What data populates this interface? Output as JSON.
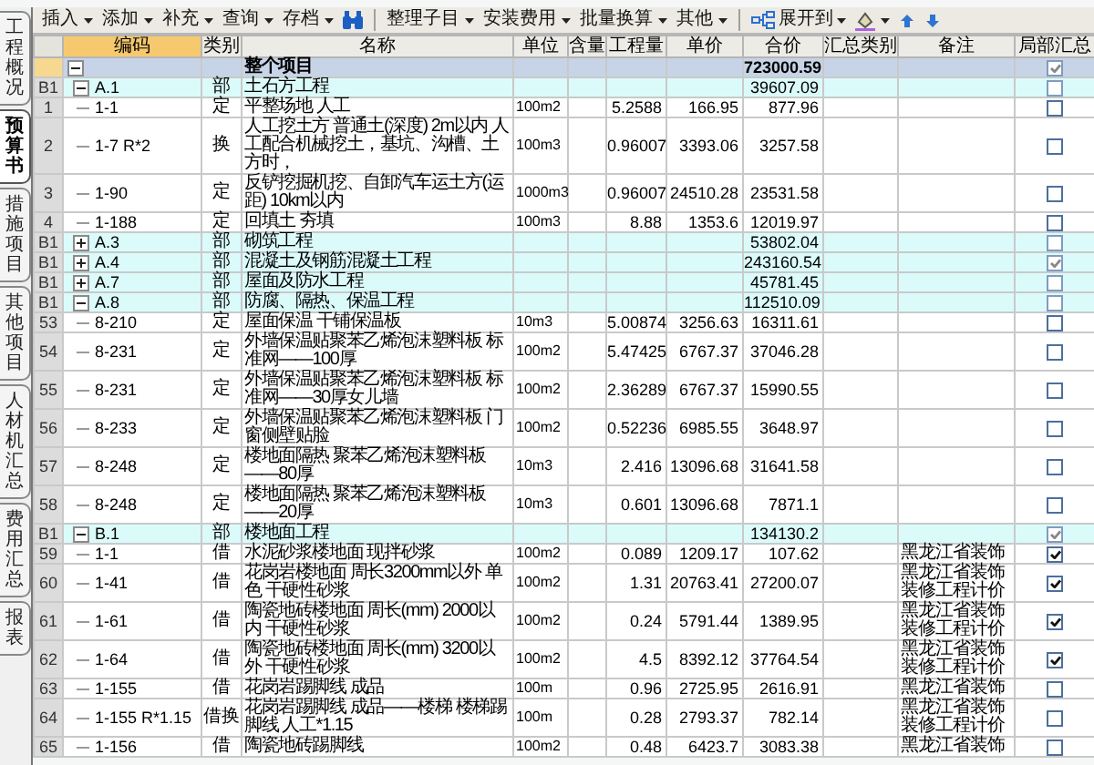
{
  "side_tabs": [
    {
      "label": "工程概况",
      "selected": false
    },
    {
      "label": "预算书",
      "selected": true
    },
    {
      "label": "措施项目",
      "selected": false
    },
    {
      "label": "其他项目",
      "selected": false
    },
    {
      "label": "人材机汇总",
      "selected": false
    },
    {
      "label": "费用汇总",
      "selected": false
    },
    {
      "label": "报表",
      "selected": false
    }
  ],
  "toolbar": [
    {
      "kind": "menu",
      "label": "插入"
    },
    {
      "kind": "menu",
      "label": "添加"
    },
    {
      "kind": "menu",
      "label": "补充"
    },
    {
      "kind": "menu",
      "label": "查询"
    },
    {
      "kind": "menu",
      "label": "存档"
    },
    {
      "kind": "search"
    },
    {
      "kind": "separator"
    },
    {
      "kind": "menu",
      "label": "整理子目"
    },
    {
      "kind": "menu",
      "label": "安装费用"
    },
    {
      "kind": "menu",
      "label": "批量换算"
    },
    {
      "kind": "menu",
      "label": "其他"
    },
    {
      "kind": "separator"
    },
    {
      "kind": "expand",
      "label": "展开到"
    },
    {
      "kind": "fill"
    },
    {
      "kind": "up"
    },
    {
      "kind": "down"
    }
  ],
  "table": {
    "columns": [
      {
        "label": "编码",
        "selected": true
      },
      {
        "label": "类别",
        "selected": false
      },
      {
        "label": "名称",
        "selected": false
      },
      {
        "label": "单位",
        "selected": false
      },
      {
        "label": "含量",
        "selected": false
      },
      {
        "label": "工程量",
        "selected": false
      },
      {
        "label": "单价",
        "selected": false
      },
      {
        "label": "合价",
        "selected": false
      },
      {
        "label": "汇总类别",
        "selected": false
      },
      {
        "label": "备注",
        "selected": false
      },
      {
        "label": "局部汇总",
        "selected": false
      }
    ],
    "rows": [
      {
        "kind": "root",
        "name": "整个项目",
        "total": "723000.59",
        "checked": true,
        "expanded": true,
        "children": [
          {
            "kind": "section",
            "row": "B1",
            "code": "A.1",
            "type": "部",
            "name": "土石方工程",
            "total": "39607.09",
            "checked": false,
            "expanded": true,
            "children": [
              {
                "kind": "item",
                "row": "1",
                "code": "1-1",
                "type": "定",
                "name": "平整场地 人工",
                "unit": "100m2",
                "qty": "5.2588",
                "price": "166.95",
                "total": "877.96",
                "checked": false
              },
              {
                "kind": "item",
                "row": "2",
                "code": "1-7 R*2",
                "type": "换",
                "name": "人工挖土方 普通土(深度) 2m以内 人工配合机械挖土，基坑、沟槽、土方时，",
                "unit": "100m3",
                "qty": "0.96007",
                "price": "3393.06",
                "total": "3257.58",
                "checked": false
              },
              {
                "kind": "item",
                "row": "3",
                "code": "1-90",
                "type": "定",
                "name": "反铲挖掘机挖、自卸汽车运土方(运距) 10km以内",
                "unit": "1000m3",
                "qty": "0.96007",
                "price": "24510.28",
                "total": "23531.58",
                "checked": false
              },
              {
                "kind": "item",
                "row": "4",
                "code": "1-188",
                "type": "定",
                "name": "回填土 夯填",
                "unit": "100m3",
                "qty": "8.88",
                "price": "1353.6",
                "total": "12019.97",
                "checked": false
              }
            ]
          },
          {
            "kind": "section",
            "row": "B1",
            "code": "A.3",
            "type": "部",
            "name": "砌筑工程",
            "total": "53802.04",
            "checked": false,
            "expanded": false
          },
          {
            "kind": "section",
            "row": "B1",
            "code": "A.4",
            "type": "部",
            "name": "混凝土及钢筋混凝土工程",
            "total": "243160.54",
            "checked": true,
            "expanded": false
          },
          {
            "kind": "section",
            "row": "B1",
            "code": "A.7",
            "type": "部",
            "name": "屋面及防水工程",
            "total": "45781.45",
            "checked": false,
            "expanded": false
          },
          {
            "kind": "section",
            "row": "B1",
            "code": "A.8",
            "type": "部",
            "name": "防腐、隔热、保温工程",
            "total": "112510.09",
            "checked": false,
            "expanded": true,
            "children": [
              {
                "kind": "item",
                "row": "53",
                "code": "8-210",
                "type": "定",
                "name": "屋面保温 干铺保温板",
                "unit": "10m3",
                "qty": "5.00874",
                "price": "3256.63",
                "total": "16311.61",
                "checked": false
              },
              {
                "kind": "item",
                "row": "54",
                "code": "8-231",
                "type": "定",
                "name": "外墙保温贴聚苯乙烯泡沫塑料板 标准网——100厚",
                "unit": "100m2",
                "qty": "5.47425",
                "price": "6767.37",
                "total": "37046.28",
                "checked": false
              },
              {
                "kind": "item",
                "row": "55",
                "code": "8-231",
                "type": "定",
                "name": "外墙保温贴聚苯乙烯泡沫塑料板 标准网——30厚女儿墙",
                "unit": "100m2",
                "qty": "2.36289",
                "price": "6767.37",
                "total": "15990.55",
                "checked": false
              },
              {
                "kind": "item",
                "row": "56",
                "code": "8-233",
                "type": "定",
                "name": "外墙保温贴聚苯乙烯泡沫塑料板 门窗侧壁贴脸",
                "unit": "100m2",
                "qty": "0.52236",
                "price": "6985.55",
                "total": "3648.97",
                "checked": false
              },
              {
                "kind": "item",
                "row": "57",
                "code": "8-248",
                "type": "定",
                "name": "楼地面隔热 聚苯乙烯泡沫塑料板——80厚",
                "unit": "10m3",
                "qty": "2.416",
                "price": "13096.68",
                "total": "31641.58",
                "checked": false
              },
              {
                "kind": "item",
                "row": "58",
                "code": "8-248",
                "type": "定",
                "name": "楼地面隔热 聚苯乙烯泡沫塑料板——20厚",
                "unit": "10m3",
                "qty": "0.601",
                "price": "13096.68",
                "total": "7871.1",
                "checked": false
              }
            ]
          },
          {
            "kind": "section",
            "row": "B1",
            "code": "B.1",
            "type": "部",
            "name": "楼地面工程",
            "total": "134130.2",
            "checked": true,
            "expanded": true,
            "children": [
              {
                "kind": "item",
                "row": "59",
                "code": "1-1",
                "type": "借",
                "name": "水泥砂浆楼地面 现拌砂浆",
                "unit": "100m2",
                "qty": "0.089",
                "price": "1209.17",
                "total": "107.62",
                "remark": "黑龙江省装饰",
                "checked": true
              },
              {
                "kind": "item",
                "row": "60",
                "code": "1-41",
                "type": "借",
                "name": "花岗岩楼地面 周长3200mm以外 单色 干硬性砂浆",
                "unit": "100m2",
                "qty": "1.31",
                "price": "20763.41",
                "total": "27200.07",
                "remark": "黑龙江省装饰装修工程计价",
                "checked": true
              },
              {
                "kind": "item",
                "row": "61",
                "code": "1-61",
                "type": "借",
                "name": "陶瓷地砖楼地面 周长(mm) 2000以内 干硬性砂浆",
                "unit": "100m2",
                "qty": "0.24",
                "price": "5791.44",
                "total": "1389.95",
                "remark": "黑龙江省装饰装修工程计价",
                "checked": true
              },
              {
                "kind": "item",
                "row": "62",
                "code": "1-64",
                "type": "借",
                "name": "陶瓷地砖楼地面 周长(mm) 3200以外 干硬性砂浆",
                "unit": "100m2",
                "qty": "4.5",
                "price": "8392.12",
                "total": "37764.54",
                "remark": "黑龙江省装饰装修工程计价",
                "checked": true
              },
              {
                "kind": "item",
                "row": "63",
                "code": "1-155",
                "type": "借",
                "name": "花岗岩踢脚线 成品",
                "unit": "100m",
                "qty": "0.96",
                "price": "2725.95",
                "total": "2616.91",
                "remark": "黑龙江省装饰",
                "checked": false
              },
              {
                "kind": "item",
                "row": "64",
                "code": "1-155 R*1.15",
                "type": "借换",
                "name": "花岗岩踢脚线 成品——楼梯 楼梯踢脚线 人工*1.15",
                "unit": "100m",
                "qty": "0.28",
                "price": "2793.37",
                "total": "782.14",
                "remark": "黑龙江省装饰装修工程计价",
                "checked": false
              },
              {
                "kind": "item",
                "row": "65",
                "code": "1-156",
                "type": "借",
                "name": "陶瓷地砖踢脚线",
                "unit": "100m2",
                "qty": "0.48",
                "price": "6423.7",
                "total": "3083.38",
                "remark": "黑龙江省装饰",
                "checked": false
              }
            ]
          }
        ]
      }
    ]
  }
}
